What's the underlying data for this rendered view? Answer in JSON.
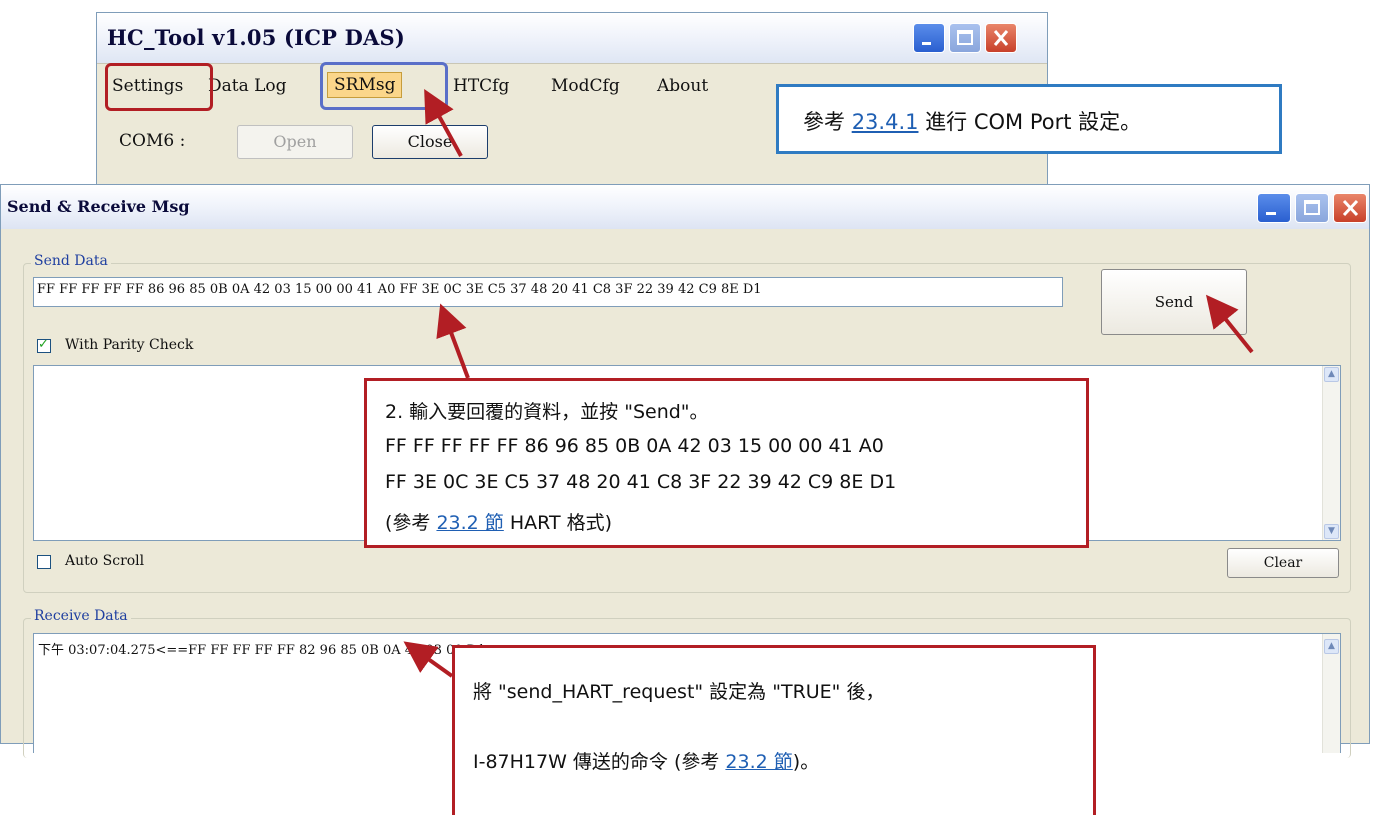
{
  "hc_tool": {
    "title": "HC_Tool v1.05  (ICP DAS)",
    "menu": [
      "Settings",
      "Data Log",
      "SRMsg",
      "HTCfg",
      "ModCfg",
      "About"
    ],
    "com_label": "COM6 :",
    "open_label": "Open",
    "close_label": "Close"
  },
  "sr_window": {
    "title": "Send & Receive Msg",
    "send_group_label": "Send Data",
    "send_value": "FF FF FF FF FF 86 96 85 0B 0A 42 03 15 00 00 41 A0 FF 3E 0C 3E C5 37 48 20 41 C8 3F 22 39 42 C9 8E D1",
    "send_button": "Send",
    "parity_label": "With Parity Check",
    "parity_checked": true,
    "auto_scroll_label": "Auto Scroll",
    "auto_scroll_checked": false,
    "clear_button": "Clear",
    "receive_group_label": "Receive Data",
    "receive_line": "下午 03:07:04.275<==FF FF FF FF FF 82 96 85 0B 0A 42 03 00 D1"
  },
  "annotations": {
    "com_note": {
      "prefix": "參考 ",
      "link": "23.4.1",
      "suffix": " 進行 COM Port 設定。"
    },
    "send_note": {
      "line1": "2. 輸入要回覆的資料，並按 \"Send\"。",
      "line2": "FF FF FF FF FF 86 96 85 0B 0A 42 03 15 00 00 41 A0",
      "line3": "FF 3E 0C 3E C5 37 48 20 41 C8 3F 22 39 42 C9 8E D1",
      "line4_prefix": "(參考  ",
      "line4_link": "23.2 節",
      "line4_suffix": " HART 格式)"
    },
    "recv_note": {
      "line1": "將 \"send_HART_request\" 設定為 \"TRUE\" 後，",
      "line2_prefix": "I-87H17W 傳送的命令 (參考  ",
      "line2_link": "23.2 節",
      "line2_suffix": ")。"
    }
  },
  "colors": {
    "callout_blue": "#2f7bc2",
    "callout_red": "#b21e24",
    "menu_highlight": "#fbd68a",
    "window_face": "#ece9d8",
    "link": "#1f5fb3"
  }
}
